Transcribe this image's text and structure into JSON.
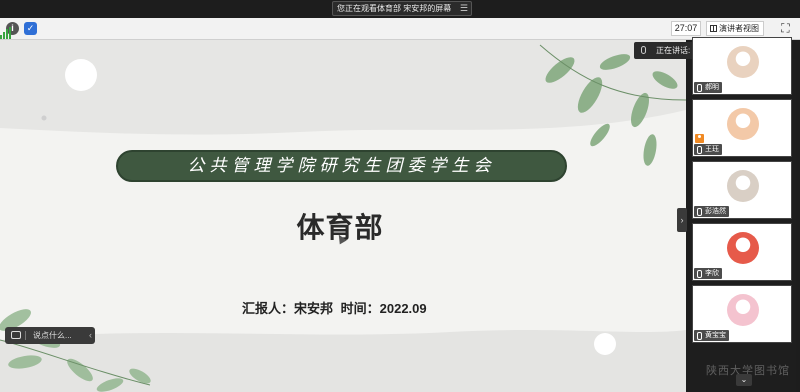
{
  "share_banner": {
    "text": "您正在观看体育部 宋安邦的屏幕",
    "menu_glyph": "☰"
  },
  "toolbar": {
    "info_icon": "info-icon",
    "shield_icon": "shield-icon",
    "signal_icon": "signal-bars-icon",
    "timer": "27:07",
    "view_label": "演讲者视图",
    "fullscreen_glyph": "⛶"
  },
  "slide": {
    "banner_title": "公共管理学院研究生团委学生会",
    "dept_title": "体育部",
    "reporter_label": "汇报人：宋安邦",
    "time_label": "时间：2022.09"
  },
  "chat": {
    "placeholder": "说点什么...",
    "collapse_glyph": "‹"
  },
  "speaker": {
    "text": "正在讲话: 体育部 宋安邦"
  },
  "panel_toggle_glyph": "›",
  "participants": [
    {
      "name": "郝明",
      "host": false,
      "avatar_color": "#e9d2bf"
    },
    {
      "name": "王珏",
      "host": true,
      "avatar_color": "#f3c9a8"
    },
    {
      "name": "彭浩然",
      "host": false,
      "avatar_color": "#d9cfc5"
    },
    {
      "name": "李欣",
      "host": false,
      "avatar_color": "#e65a4a"
    },
    {
      "name": "黄宝宝",
      "host": false,
      "avatar_color": "#f4c3cf"
    }
  ],
  "scroll_down_glyph": "⌄",
  "watermark": "陕西大学图书馆",
  "colors": {
    "banner_green": "#3f5840",
    "leaf_green": "#7fa77b",
    "toolbar_bg": "#f2f2f2",
    "dark_bg": "#1d1d1d"
  }
}
